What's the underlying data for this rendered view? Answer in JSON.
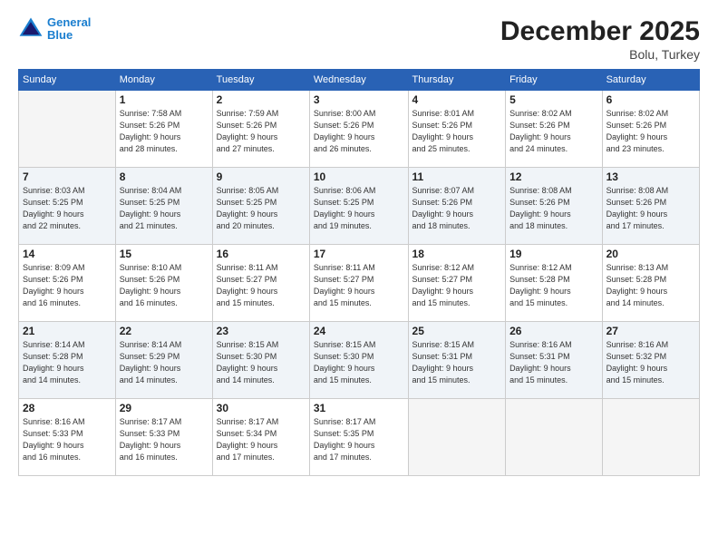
{
  "header": {
    "logo_line1": "General",
    "logo_line2": "Blue",
    "month": "December 2025",
    "location": "Bolu, Turkey"
  },
  "weekdays": [
    "Sunday",
    "Monday",
    "Tuesday",
    "Wednesday",
    "Thursday",
    "Friday",
    "Saturday"
  ],
  "weeks": [
    [
      {
        "day": "",
        "info": ""
      },
      {
        "day": "1",
        "info": "Sunrise: 7:58 AM\nSunset: 5:26 PM\nDaylight: 9 hours\nand 28 minutes."
      },
      {
        "day": "2",
        "info": "Sunrise: 7:59 AM\nSunset: 5:26 PM\nDaylight: 9 hours\nand 27 minutes."
      },
      {
        "day": "3",
        "info": "Sunrise: 8:00 AM\nSunset: 5:26 PM\nDaylight: 9 hours\nand 26 minutes."
      },
      {
        "day": "4",
        "info": "Sunrise: 8:01 AM\nSunset: 5:26 PM\nDaylight: 9 hours\nand 25 minutes."
      },
      {
        "day": "5",
        "info": "Sunrise: 8:02 AM\nSunset: 5:26 PM\nDaylight: 9 hours\nand 24 minutes."
      },
      {
        "day": "6",
        "info": "Sunrise: 8:02 AM\nSunset: 5:26 PM\nDaylight: 9 hours\nand 23 minutes."
      }
    ],
    [
      {
        "day": "7",
        "info": "Sunrise: 8:03 AM\nSunset: 5:25 PM\nDaylight: 9 hours\nand 22 minutes."
      },
      {
        "day": "8",
        "info": "Sunrise: 8:04 AM\nSunset: 5:25 PM\nDaylight: 9 hours\nand 21 minutes."
      },
      {
        "day": "9",
        "info": "Sunrise: 8:05 AM\nSunset: 5:25 PM\nDaylight: 9 hours\nand 20 minutes."
      },
      {
        "day": "10",
        "info": "Sunrise: 8:06 AM\nSunset: 5:25 PM\nDaylight: 9 hours\nand 19 minutes."
      },
      {
        "day": "11",
        "info": "Sunrise: 8:07 AM\nSunset: 5:26 PM\nDaylight: 9 hours\nand 18 minutes."
      },
      {
        "day": "12",
        "info": "Sunrise: 8:08 AM\nSunset: 5:26 PM\nDaylight: 9 hours\nand 18 minutes."
      },
      {
        "day": "13",
        "info": "Sunrise: 8:08 AM\nSunset: 5:26 PM\nDaylight: 9 hours\nand 17 minutes."
      }
    ],
    [
      {
        "day": "14",
        "info": "Sunrise: 8:09 AM\nSunset: 5:26 PM\nDaylight: 9 hours\nand 16 minutes."
      },
      {
        "day": "15",
        "info": "Sunrise: 8:10 AM\nSunset: 5:26 PM\nDaylight: 9 hours\nand 16 minutes."
      },
      {
        "day": "16",
        "info": "Sunrise: 8:11 AM\nSunset: 5:27 PM\nDaylight: 9 hours\nand 15 minutes."
      },
      {
        "day": "17",
        "info": "Sunrise: 8:11 AM\nSunset: 5:27 PM\nDaylight: 9 hours\nand 15 minutes."
      },
      {
        "day": "18",
        "info": "Sunrise: 8:12 AM\nSunset: 5:27 PM\nDaylight: 9 hours\nand 15 minutes."
      },
      {
        "day": "19",
        "info": "Sunrise: 8:12 AM\nSunset: 5:28 PM\nDaylight: 9 hours\nand 15 minutes."
      },
      {
        "day": "20",
        "info": "Sunrise: 8:13 AM\nSunset: 5:28 PM\nDaylight: 9 hours\nand 14 minutes."
      }
    ],
    [
      {
        "day": "21",
        "info": "Sunrise: 8:14 AM\nSunset: 5:28 PM\nDaylight: 9 hours\nand 14 minutes."
      },
      {
        "day": "22",
        "info": "Sunrise: 8:14 AM\nSunset: 5:29 PM\nDaylight: 9 hours\nand 14 minutes."
      },
      {
        "day": "23",
        "info": "Sunrise: 8:15 AM\nSunset: 5:30 PM\nDaylight: 9 hours\nand 14 minutes."
      },
      {
        "day": "24",
        "info": "Sunrise: 8:15 AM\nSunset: 5:30 PM\nDaylight: 9 hours\nand 15 minutes."
      },
      {
        "day": "25",
        "info": "Sunrise: 8:15 AM\nSunset: 5:31 PM\nDaylight: 9 hours\nand 15 minutes."
      },
      {
        "day": "26",
        "info": "Sunrise: 8:16 AM\nSunset: 5:31 PM\nDaylight: 9 hours\nand 15 minutes."
      },
      {
        "day": "27",
        "info": "Sunrise: 8:16 AM\nSunset: 5:32 PM\nDaylight: 9 hours\nand 15 minutes."
      }
    ],
    [
      {
        "day": "28",
        "info": "Sunrise: 8:16 AM\nSunset: 5:33 PM\nDaylight: 9 hours\nand 16 minutes."
      },
      {
        "day": "29",
        "info": "Sunrise: 8:17 AM\nSunset: 5:33 PM\nDaylight: 9 hours\nand 16 minutes."
      },
      {
        "day": "30",
        "info": "Sunrise: 8:17 AM\nSunset: 5:34 PM\nDaylight: 9 hours\nand 17 minutes."
      },
      {
        "day": "31",
        "info": "Sunrise: 8:17 AM\nSunset: 5:35 PM\nDaylight: 9 hours\nand 17 minutes."
      },
      {
        "day": "",
        "info": ""
      },
      {
        "day": "",
        "info": ""
      },
      {
        "day": "",
        "info": ""
      }
    ]
  ]
}
